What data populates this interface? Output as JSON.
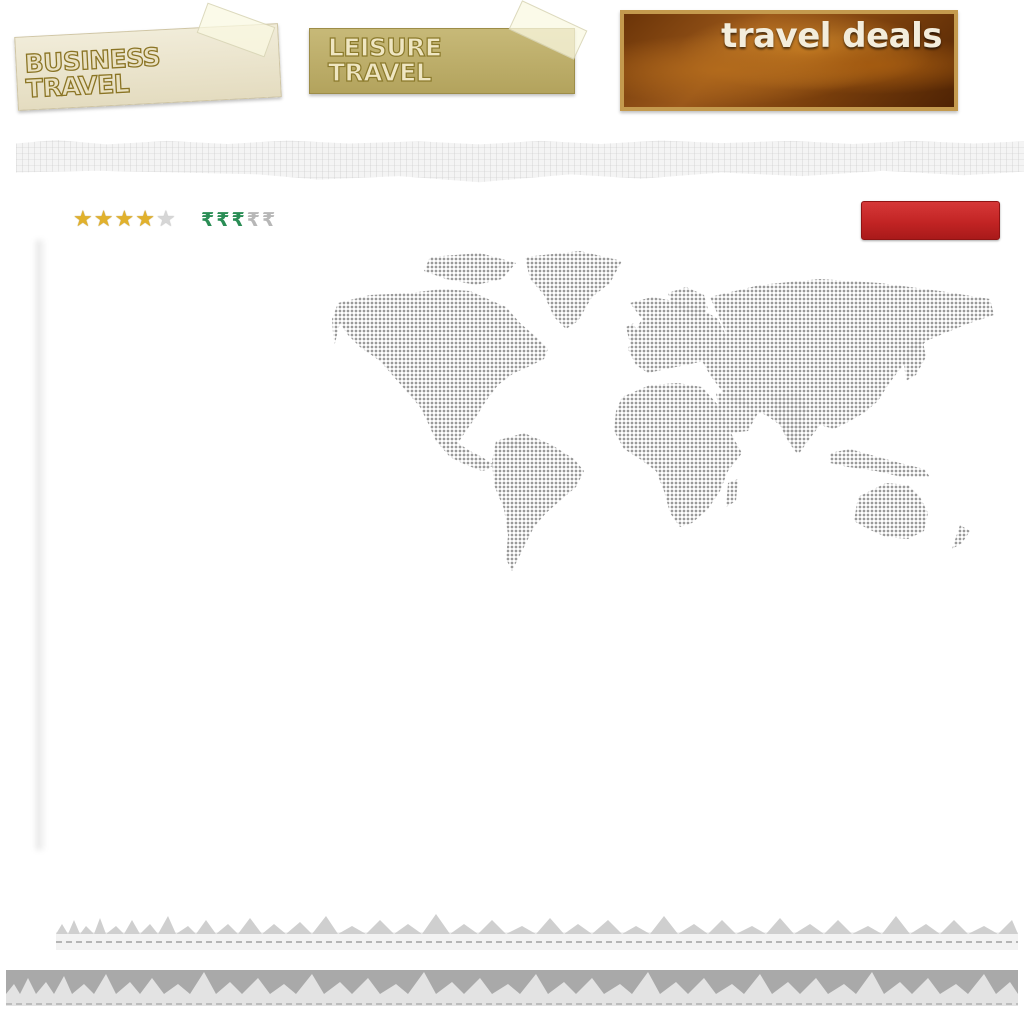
{
  "nav": {
    "business": {
      "label": "BUSINESS\nTRAVEL"
    },
    "leisure": {
      "label": "LEISURE\nTRAVEL"
    },
    "deals": {
      "label": "travel deals"
    }
  },
  "rating": {
    "stars_filled": 4,
    "stars_total": 5,
    "price_filled": 3,
    "price_total": 5,
    "price_symbol": "₹"
  },
  "action_button": {
    "label": ""
  },
  "colors": {
    "star_on": "#e1b12c",
    "rupee_on": "#2a8d55",
    "button_red": "#c22424",
    "map_dots": "#9a9a9a"
  },
  "icons": [
    "star-icon",
    "rupee-icon",
    "world-map"
  ]
}
